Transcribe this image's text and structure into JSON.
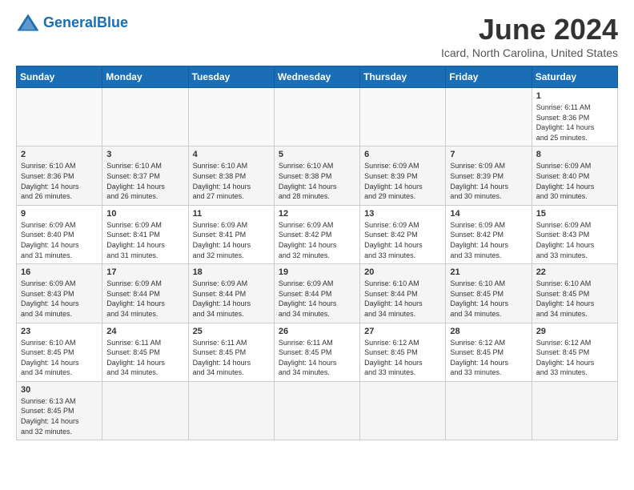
{
  "logo": {
    "text_general": "General",
    "text_blue": "Blue"
  },
  "title": "June 2024",
  "location": "Icard, North Carolina, United States",
  "weekdays": [
    "Sunday",
    "Monday",
    "Tuesday",
    "Wednesday",
    "Thursday",
    "Friday",
    "Saturday"
  ],
  "weeks": [
    [
      {
        "day": "",
        "info": ""
      },
      {
        "day": "",
        "info": ""
      },
      {
        "day": "",
        "info": ""
      },
      {
        "day": "",
        "info": ""
      },
      {
        "day": "",
        "info": ""
      },
      {
        "day": "",
        "info": ""
      },
      {
        "day": "1",
        "info": "Sunrise: 6:11 AM\nSunset: 8:36 PM\nDaylight: 14 hours\nand 25 minutes."
      }
    ],
    [
      {
        "day": "2",
        "info": "Sunrise: 6:10 AM\nSunset: 8:36 PM\nDaylight: 14 hours\nand 26 minutes."
      },
      {
        "day": "3",
        "info": "Sunrise: 6:10 AM\nSunset: 8:37 PM\nDaylight: 14 hours\nand 26 minutes."
      },
      {
        "day": "4",
        "info": "Sunrise: 6:10 AM\nSunset: 8:38 PM\nDaylight: 14 hours\nand 27 minutes."
      },
      {
        "day": "5",
        "info": "Sunrise: 6:10 AM\nSunset: 8:38 PM\nDaylight: 14 hours\nand 28 minutes."
      },
      {
        "day": "6",
        "info": "Sunrise: 6:09 AM\nSunset: 8:39 PM\nDaylight: 14 hours\nand 29 minutes."
      },
      {
        "day": "7",
        "info": "Sunrise: 6:09 AM\nSunset: 8:39 PM\nDaylight: 14 hours\nand 30 minutes."
      },
      {
        "day": "8",
        "info": "Sunrise: 6:09 AM\nSunset: 8:40 PM\nDaylight: 14 hours\nand 30 minutes."
      }
    ],
    [
      {
        "day": "9",
        "info": "Sunrise: 6:09 AM\nSunset: 8:40 PM\nDaylight: 14 hours\nand 31 minutes."
      },
      {
        "day": "10",
        "info": "Sunrise: 6:09 AM\nSunset: 8:41 PM\nDaylight: 14 hours\nand 31 minutes."
      },
      {
        "day": "11",
        "info": "Sunrise: 6:09 AM\nSunset: 8:41 PM\nDaylight: 14 hours\nand 32 minutes."
      },
      {
        "day": "12",
        "info": "Sunrise: 6:09 AM\nSunset: 8:42 PM\nDaylight: 14 hours\nand 32 minutes."
      },
      {
        "day": "13",
        "info": "Sunrise: 6:09 AM\nSunset: 8:42 PM\nDaylight: 14 hours\nand 33 minutes."
      },
      {
        "day": "14",
        "info": "Sunrise: 6:09 AM\nSunset: 8:42 PM\nDaylight: 14 hours\nand 33 minutes."
      },
      {
        "day": "15",
        "info": "Sunrise: 6:09 AM\nSunset: 8:43 PM\nDaylight: 14 hours\nand 33 minutes."
      }
    ],
    [
      {
        "day": "16",
        "info": "Sunrise: 6:09 AM\nSunset: 8:43 PM\nDaylight: 14 hours\nand 34 minutes."
      },
      {
        "day": "17",
        "info": "Sunrise: 6:09 AM\nSunset: 8:44 PM\nDaylight: 14 hours\nand 34 minutes."
      },
      {
        "day": "18",
        "info": "Sunrise: 6:09 AM\nSunset: 8:44 PM\nDaylight: 14 hours\nand 34 minutes."
      },
      {
        "day": "19",
        "info": "Sunrise: 6:09 AM\nSunset: 8:44 PM\nDaylight: 14 hours\nand 34 minutes."
      },
      {
        "day": "20",
        "info": "Sunrise: 6:10 AM\nSunset: 8:44 PM\nDaylight: 14 hours\nand 34 minutes."
      },
      {
        "day": "21",
        "info": "Sunrise: 6:10 AM\nSunset: 8:45 PM\nDaylight: 14 hours\nand 34 minutes."
      },
      {
        "day": "22",
        "info": "Sunrise: 6:10 AM\nSunset: 8:45 PM\nDaylight: 14 hours\nand 34 minutes."
      }
    ],
    [
      {
        "day": "23",
        "info": "Sunrise: 6:10 AM\nSunset: 8:45 PM\nDaylight: 14 hours\nand 34 minutes."
      },
      {
        "day": "24",
        "info": "Sunrise: 6:11 AM\nSunset: 8:45 PM\nDaylight: 14 hours\nand 34 minutes."
      },
      {
        "day": "25",
        "info": "Sunrise: 6:11 AM\nSunset: 8:45 PM\nDaylight: 14 hours\nand 34 minutes."
      },
      {
        "day": "26",
        "info": "Sunrise: 6:11 AM\nSunset: 8:45 PM\nDaylight: 14 hours\nand 34 minutes."
      },
      {
        "day": "27",
        "info": "Sunrise: 6:12 AM\nSunset: 8:45 PM\nDaylight: 14 hours\nand 33 minutes."
      },
      {
        "day": "28",
        "info": "Sunrise: 6:12 AM\nSunset: 8:45 PM\nDaylight: 14 hours\nand 33 minutes."
      },
      {
        "day": "29",
        "info": "Sunrise: 6:12 AM\nSunset: 8:45 PM\nDaylight: 14 hours\nand 33 minutes."
      }
    ],
    [
      {
        "day": "30",
        "info": "Sunrise: 6:13 AM\nSunset: 8:45 PM\nDaylight: 14 hours\nand 32 minutes."
      },
      {
        "day": "",
        "info": ""
      },
      {
        "day": "",
        "info": ""
      },
      {
        "day": "",
        "info": ""
      },
      {
        "day": "",
        "info": ""
      },
      {
        "day": "",
        "info": ""
      },
      {
        "day": "",
        "info": ""
      }
    ]
  ]
}
